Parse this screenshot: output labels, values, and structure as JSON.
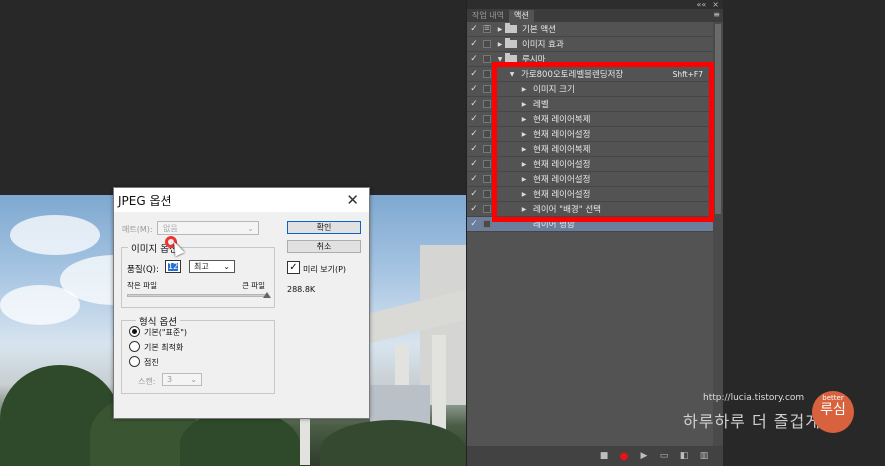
{
  "panel": {
    "tabs": [
      {
        "label": "작업 내역"
      },
      {
        "label": "액션"
      }
    ],
    "top_controls": {
      "collapse": "««",
      "close": "×"
    },
    "rows": [
      {
        "label": "기본 액션",
        "indent": 1,
        "expand": "▶",
        "folder": true,
        "box": "☰"
      },
      {
        "label": "이미지 효과",
        "indent": 1,
        "expand": "▶",
        "folder": true,
        "box": ""
      },
      {
        "label": "루시마",
        "indent": 1,
        "expand": "▼",
        "folder": true,
        "box": ""
      },
      {
        "label": "가로800오토레벨블렌딩저장",
        "indent": 2,
        "expand": "▼",
        "folder": false,
        "box": "",
        "shortcut": "Shft+F7"
      },
      {
        "label": "이미지 크기",
        "indent": 3,
        "expand": "▶",
        "folder": false,
        "box": ""
      },
      {
        "label": "레벨",
        "indent": 3,
        "expand": "▶",
        "folder": false,
        "box": ""
      },
      {
        "label": "현재 레이어복제",
        "indent": 3,
        "expand": "▶",
        "folder": false,
        "box": ""
      },
      {
        "label": "현재 레이어설정",
        "indent": 3,
        "expand": "▶",
        "folder": false,
        "box": ""
      },
      {
        "label": "현재 레이어복제",
        "indent": 3,
        "expand": "▶",
        "folder": false,
        "box": ""
      },
      {
        "label": "현재 레이어설정",
        "indent": 3,
        "expand": "▶",
        "folder": false,
        "box": ""
      },
      {
        "label": "현재 레이어설정",
        "indent": 3,
        "expand": "▶",
        "folder": false,
        "box": ""
      },
      {
        "label": "현재 레이어설정",
        "indent": 3,
        "expand": "▶",
        "folder": false,
        "box": ""
      },
      {
        "label": "레이어 \"배경\" 선택",
        "indent": 3,
        "expand": "▶",
        "folder": false,
        "box": ""
      },
      {
        "label": "레이어 병합",
        "indent": 3,
        "expand": "",
        "folder": false,
        "box": "",
        "selected": true
      }
    ]
  },
  "dialog": {
    "title": "JPEG 옵션",
    "close": "✕",
    "matte_label": "매트(M):",
    "matte_value": "없음",
    "image_options_legend": "이미지 옵션",
    "quality_label": "품질(Q):",
    "quality_value": "12",
    "quality_preset": "최고",
    "small_file": "작은 파일",
    "large_file": "큰 파일",
    "quality_level": 1.0,
    "format_legend": "형식 옵션",
    "format_options": [
      "기본(\"표준\")",
      "기본 최적화",
      "점진"
    ],
    "format_selected": 0,
    "scan_label": "스캔:",
    "scan_value": "3",
    "ok": "확인",
    "cancel": "취소",
    "preview_label": "미리 보기(P)",
    "preview_checked": true,
    "file_size": "288.8K"
  },
  "watermark": {
    "url": "http://lucia.tistory.com",
    "text": "하루하루 더 즐겁게",
    "logo_small": "better",
    "logo_big": "루심"
  },
  "colors": {
    "highlight": "#ff0000",
    "selection": "#6b7f9c",
    "record": "#e11111"
  }
}
